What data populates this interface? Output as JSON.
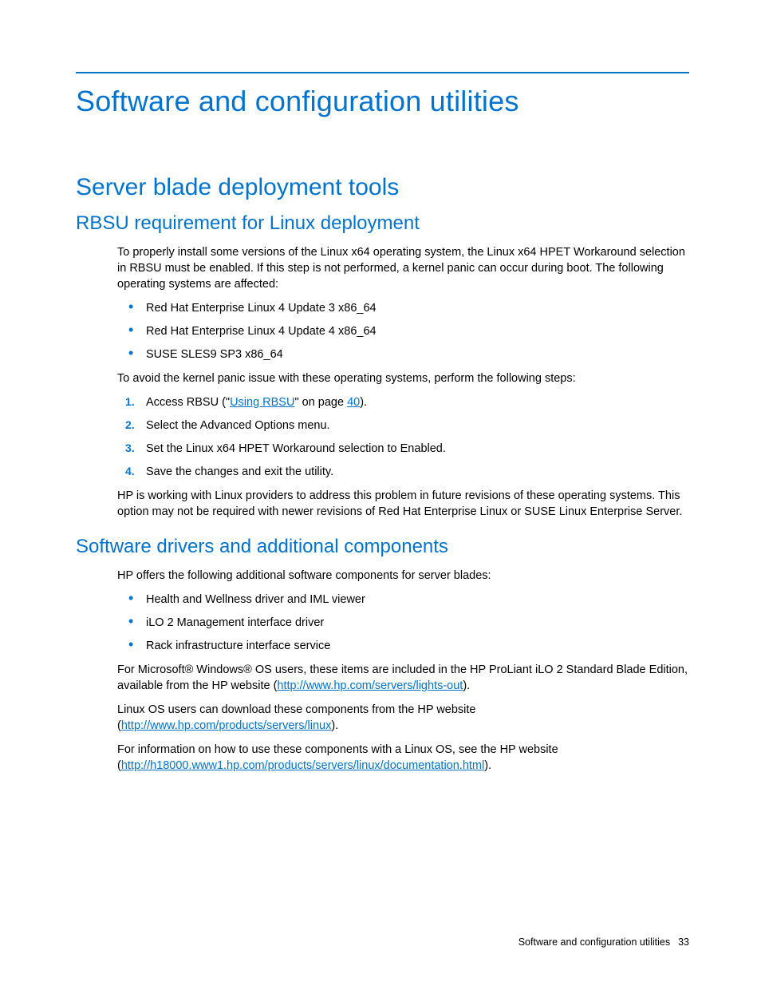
{
  "title": "Software and configuration utilities",
  "h2": "Server blade deployment tools",
  "sec1": {
    "h3": "RBSU requirement for Linux deployment",
    "p1": "To properly install some versions of the Linux x64 operating system, the Linux x64 HPET Workaround selection in RBSU must be enabled. If this step is not performed, a kernel panic can occur during boot. The following operating systems are affected:",
    "bullets": [
      "Red Hat Enterprise Linux 4 Update 3 x86_64",
      "Red Hat Enterprise Linux 4 Update 4 x86_64",
      "SUSE SLES9 SP3 x86_64"
    ],
    "p2": "To avoid the kernel panic issue with these operating systems, perform the following steps:",
    "step1_a": "Access RBSU (\"",
    "step1_link": "Using RBSU",
    "step1_b": "\" on page ",
    "step1_page": "40",
    "step1_c": ").",
    "steps_rest": [
      "Select the Advanced Options menu.",
      "Set the Linux x64 HPET Workaround selection to Enabled.",
      "Save the changes and exit the utility."
    ],
    "p3": "HP is working with Linux providers to address this problem in future revisions of these operating systems. This option may not be required with newer revisions of Red Hat Enterprise Linux or SUSE Linux Enterprise Server."
  },
  "sec2": {
    "h3": "Software drivers and additional components",
    "p1": "HP offers the following additional software components for server blades:",
    "bullets": [
      "Health and Wellness driver and IML viewer",
      "iLO 2 Management interface driver",
      "Rack infrastructure interface service"
    ],
    "p2a": "For Microsoft® Windows® OS users, these items are included in the HP ProLiant iLO 2 Standard Blade Edition, available from the HP website (",
    "p2link": "http://www.hp.com/servers/lights-out",
    "p2b": ").",
    "p3a": "Linux OS users can download these components from the HP website (",
    "p3link": "http://www.hp.com/products/servers/linux",
    "p3b": ").",
    "p4a": "For information on how to use these components with a Linux OS, see the HP website (",
    "p4link": "http://h18000.www1.hp.com/products/servers/linux/documentation.html",
    "p4b": ")."
  },
  "footer": {
    "label": "Software and configuration utilities",
    "page": "33"
  }
}
